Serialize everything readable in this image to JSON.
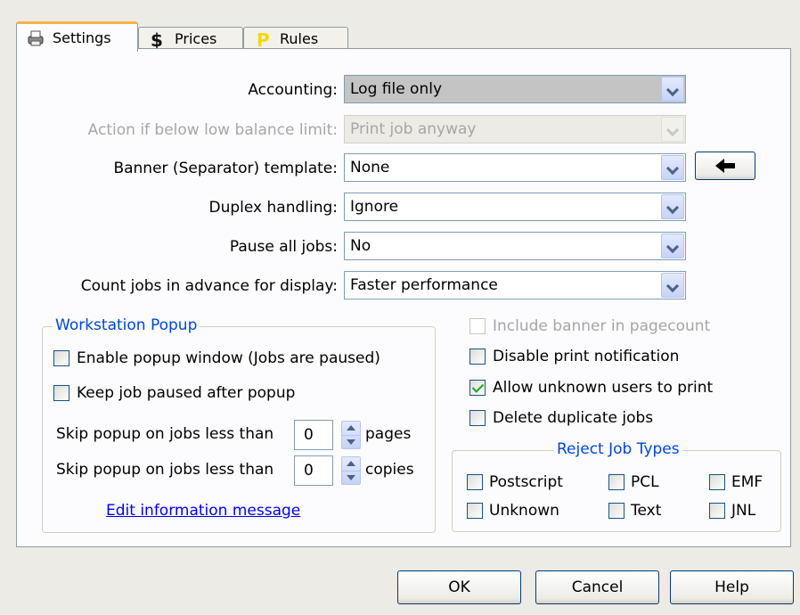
{
  "tabs": [
    {
      "label": "Settings",
      "icon": "printer-icon"
    },
    {
      "label": "Prices",
      "icon": "dollar-icon"
    },
    {
      "label": "Rules",
      "icon": "rules-p-icon"
    }
  ],
  "fields": {
    "accounting": {
      "label": "Accounting:",
      "value": "Log file only"
    },
    "low_balance": {
      "label": "Action if below low balance limit:",
      "value": "Print job anyway"
    },
    "banner": {
      "label": "Banner (Separator) template:",
      "value": "None"
    },
    "duplex": {
      "label": "Duplex handling:",
      "value": "Ignore"
    },
    "pause": {
      "label": "Pause all jobs:",
      "value": "No"
    },
    "count": {
      "label": "Count jobs in advance for display:",
      "value": "Faster performance"
    }
  },
  "banner_action_icon": "left-arrow-icon",
  "popup_group": {
    "title": "Workstation Popup",
    "enable_popup": "Enable popup window  (Jobs are paused)",
    "keep_paused": "Keep job paused after popup",
    "skip_pages_label": "Skip popup on jobs less than",
    "skip_pages_value": "0",
    "skip_pages_unit": "pages",
    "skip_copies_label": "Skip popup on jobs less than",
    "skip_copies_value": "0",
    "skip_copies_unit": "copies",
    "edit_link": "Edit information message"
  },
  "options": {
    "include_banner": "Include banner in pagecount",
    "disable_notification": "Disable print notification",
    "allow_unknown": "Allow unknown users to print",
    "delete_duplicates": "Delete duplicate jobs"
  },
  "reject_group": {
    "title": "Reject Job Types",
    "types": [
      "Postscript",
      "PCL",
      "EMF",
      "Unknown",
      "Text",
      "JNL"
    ]
  },
  "buttons": {
    "ok": "OK",
    "cancel": "Cancel",
    "help": "Help"
  },
  "colors": {
    "tab_accent": "#f7b443",
    "group_title": "#0046d5",
    "link": "#0000ee",
    "check": "#21a121"
  }
}
